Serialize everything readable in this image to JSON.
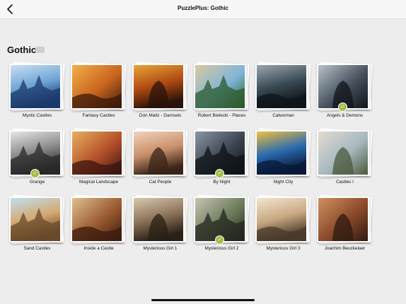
{
  "navbar": {
    "title": "PuzzlePlus: Gothic"
  },
  "section": {
    "title": "Gothic"
  },
  "puzzles": [
    {
      "name": "Mystic Castles",
      "completed": false,
      "palette": [
        "#1b3a6b",
        "#6fa4d6",
        "#c9dff2"
      ]
    },
    {
      "name": "Fantasy Castles",
      "completed": false,
      "palette": [
        "#3a1a0a",
        "#c9641e",
        "#f2b04a"
      ]
    },
    {
      "name": "Don Maitz - Damsels",
      "completed": false,
      "palette": [
        "#2a130a",
        "#b04a12",
        "#e8a53a"
      ]
    },
    {
      "name": "Robert Bielecki - Places",
      "completed": false,
      "palette": [
        "#2b5a2a",
        "#7fb5d8",
        "#d9c9a0"
      ]
    },
    {
      "name": "Catwoman",
      "completed": false,
      "palette": [
        "#0f1418",
        "#3a4a55",
        "#9aa7b0"
      ]
    },
    {
      "name": "Angels & Demons",
      "completed": true,
      "palette": [
        "#101418",
        "#46525e",
        "#b8c2c9"
      ]
    },
    {
      "name": "Grange",
      "completed": true,
      "palette": [
        "#2a2a2a",
        "#8a8a8a",
        "#e6e6e6"
      ]
    },
    {
      "name": "Magical Landscape",
      "completed": false,
      "palette": [
        "#3a1410",
        "#b4502a",
        "#e8b060"
      ]
    },
    {
      "name": "Cat People",
      "completed": false,
      "palette": [
        "#3a2418",
        "#c9906a",
        "#f2d3bc"
      ]
    },
    {
      "name": "By Night",
      "completed": true,
      "palette": [
        "#0e1116",
        "#3a4450",
        "#8a96a2"
      ]
    },
    {
      "name": "Night City",
      "completed": false,
      "palette": [
        "#0a1a3a",
        "#2a6ab0",
        "#f0c040"
      ]
    },
    {
      "name": "Castles I",
      "completed": false,
      "palette": [
        "#4a5a3a",
        "#a8b8c0",
        "#e0dcd0"
      ]
    },
    {
      "name": "Sand Castles",
      "completed": false,
      "palette": [
        "#6a4a2a",
        "#d4a870",
        "#bfe0ef"
      ]
    },
    {
      "name": "Inside a Castle",
      "completed": false,
      "palette": [
        "#3a1a0e",
        "#9a5a30",
        "#e0c090"
      ]
    },
    {
      "name": "Mysterious Girl 1",
      "completed": false,
      "palette": [
        "#2a2016",
        "#8a7258",
        "#d8c8b0"
      ]
    },
    {
      "name": "Mysterious Girl 2",
      "completed": true,
      "palette": [
        "#22261e",
        "#6a7a5a",
        "#c8c4b0"
      ]
    },
    {
      "name": "Mysterious Girl 3",
      "completed": false,
      "palette": [
        "#4a3a2a",
        "#c8a880",
        "#f2e6d2"
      ]
    },
    {
      "name": "Joachim Beuckelaer",
      "completed": false,
      "palette": [
        "#2e1a10",
        "#8a4a2a",
        "#d09060"
      ]
    }
  ]
}
